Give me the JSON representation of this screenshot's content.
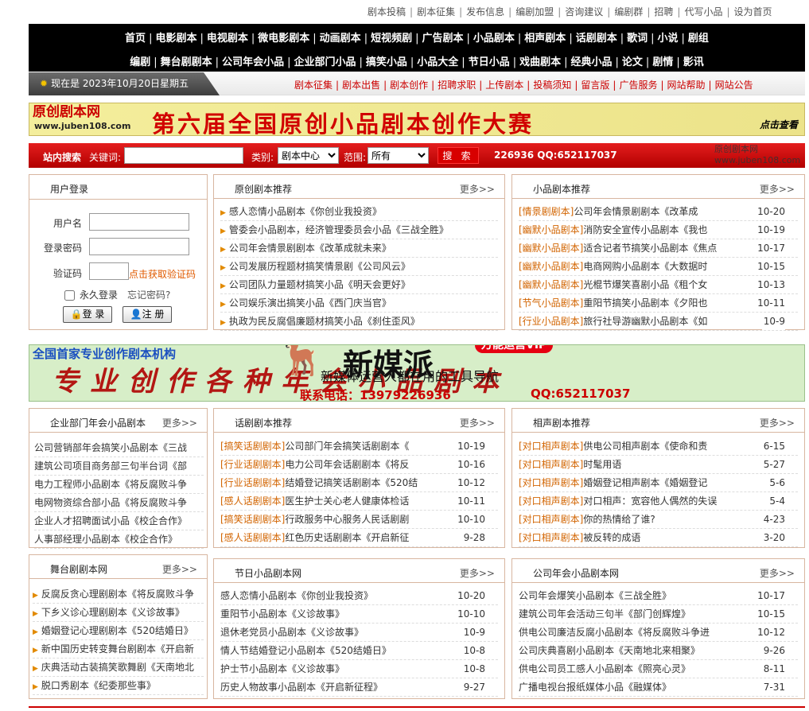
{
  "top_links": [
    "剧本投稿",
    "剧本征集",
    "发布信息",
    "编剧加盟",
    "咨询建议",
    "编剧群",
    "招聘",
    "代写小品",
    "设为首页"
  ],
  "nav_row1": [
    "首页",
    "电影剧本",
    "电视剧本",
    "微电影剧本",
    "动画剧本",
    "短视频剧",
    "广告剧本",
    "小品剧本",
    "相声剧本",
    "话剧剧本",
    "歌词",
    "小说",
    "剧组"
  ],
  "nav_row2": [
    "编剧",
    "舞台剧剧本",
    "公司年会小品",
    "企业部门小品",
    "搞笑小品",
    "小品大全",
    "节日小品",
    "戏曲剧本",
    "经典小品",
    "论文",
    "剧情",
    "影讯"
  ],
  "date_text": "现在是 2023年10月20日星期五",
  "sub_links": [
    "剧本征集",
    "剧本出售",
    "剧本创作",
    "招聘求职",
    "上传剧本",
    "投稿须知",
    "留言版",
    "广告服务",
    "网站帮助",
    "网站公告"
  ],
  "banner1": {
    "logo": "原创剧本网",
    "url": "www.juben108.com",
    "title": "第六届全国原创小品剧本创作大赛",
    "click": "点击查看"
  },
  "search": {
    "site_search": "站内搜索",
    "keyword_label": "关键词:",
    "category_label": "类别:",
    "category_value": "剧本中心",
    "range_label": "范围:",
    "range_value": "所有",
    "button": "搜 索",
    "contact": "226936 QQ:652117037",
    "watermark1": "原创剧本网",
    "watermark2": "www.juben108.com"
  },
  "login": {
    "title": "用户登录",
    "username_label": "用户名",
    "password_label": "登录密码",
    "code_label": "验证码",
    "get_code": "点击获取验证码",
    "remember": "永久登录",
    "forgot": "忘记密码?",
    "login_btn": "登 录",
    "register_btn": "注 册"
  },
  "more": "更多>>",
  "original_recommend": {
    "title": "原创剧本推荐",
    "items": [
      "感人恋情小品剧本《你创业我投资》",
      "管委会小品剧本，经济管理委员会小品《三战全胜》",
      "公司年会情景剧剧本《改革成就未来》",
      "公司发展历程题材搞笑情景剧《公司风云》",
      "公司团队力量题材搞笑小品《明天会更好》",
      "公司娱乐演出搞笑小品《西门庆当官》",
      "执政为民反腐倡廉题材搞笑小品《刹住歪风》"
    ]
  },
  "sketch_recommend": {
    "title": "小品剧本推荐",
    "items": [
      {
        "tag": "[情景剧剧本]",
        "text": "公司年会情景剧剧本《改革成",
        "date": "10-20"
      },
      {
        "tag": "[幽默小品剧本]",
        "text": "消防安全宣传小品剧本《我也",
        "date": "10-19"
      },
      {
        "tag": "[幽默小品剧本]",
        "text": "适合记者节搞笑小品剧本《焦点",
        "date": "10-17"
      },
      {
        "tag": "[幽默小品剧本]",
        "text": "电商网购小品剧本《大数据时",
        "date": "10-15"
      },
      {
        "tag": "[幽默小品剧本]",
        "text": "光棍节爆笑喜剧小品《租个女",
        "date": "10-13"
      },
      {
        "tag": "[节气小品剧本]",
        "text": "重阳节搞笑小品剧本《夕阳也",
        "date": "10-11"
      },
      {
        "tag": "[行业小品剧本]",
        "text": "旅行社导游幽默小品剧本《如",
        "date": "10-9"
      }
    ]
  },
  "banner2": {
    "top": "全国首家专业创作剧本机构",
    "big": "专业创作各种年会小品剧本",
    "phone": "联系电话：13979226936",
    "qq": "QQ:652117037",
    "overlay_name": "新媒派",
    "overlay_badge": "万能运营VIP",
    "overlay_sub": "新媒体运营人都在用的工具导航"
  },
  "enterprise": {
    "title": "企业部门年会小品剧本",
    "items": [
      "公司营销部年会搞笑小品剧本《三战",
      "建筑公司项目商务部三句半台词《部",
      "电力工程师小品剧本《将反腐败斗争",
      "电网物资综合部小品《将反腐败斗争",
      "企业人才招聘面试小品《校企合作》",
      "人事部经理小品剧本《校企合作》"
    ]
  },
  "drama": {
    "title": "话剧剧本推荐",
    "items": [
      {
        "tag": "[搞笑话剧剧本]",
        "text": "公司部门年会搞笑话剧剧本《",
        "date": "10-19"
      },
      {
        "tag": "[行业话剧剧本]",
        "text": "电力公司年会话剧剧本《将反",
        "date": "10-16"
      },
      {
        "tag": "[行业话剧剧本]",
        "text": "结婚登记搞笑话剧剧本《520结",
        "date": "10-12"
      },
      {
        "tag": "[感人话剧剧本]",
        "text": "医生护士关心老人健康体检话",
        "date": "10-11"
      },
      {
        "tag": "[搞笑话剧剧本]",
        "text": "行政服务中心服务人民话剧剧",
        "date": "10-10"
      },
      {
        "tag": "[感人话剧剧本]",
        "text": "红色历史话剧剧本《开启新征",
        "date": "9-28"
      }
    ]
  },
  "crosstalk": {
    "title": "相声剧本推荐",
    "items": [
      {
        "tag": "[对口相声剧本]",
        "text": "供电公司相声剧本《使命和责",
        "date": "6-15"
      },
      {
        "tag": "[对口相声剧本]",
        "text": "时髦用语",
        "date": "5-27"
      },
      {
        "tag": "[对口相声剧本]",
        "text": "婚姻登记相声剧本《婚姻登记",
        "date": "5-6"
      },
      {
        "tag": "[对口相声剧本]",
        "text": "对口相声：宽容他人偶然的失误",
        "date": "5-4"
      },
      {
        "tag": "[对口相声剧本]",
        "text": "你的热情给了谁?",
        "date": "4-23"
      },
      {
        "tag": "[对口相声剧本]",
        "text": "被反转的成语",
        "date": "3-20"
      }
    ]
  },
  "stage": {
    "title": "舞台剧剧本网",
    "items": [
      "反腐反贪心理剧剧本《将反腐败斗争",
      "下乡义诊心理剧剧本《义诊故事》",
      "婚姻登记心理剧剧本《520结婚日》",
      "新中国历史转变舞台剧剧本《开启新",
      "庆典活动古装搞笑歌舞剧《天南地北",
      "脱口秀剧本《纪委那些事》"
    ]
  },
  "festival": {
    "title": "节日小品剧本网",
    "items": [
      {
        "text": "感人恋情小品剧本《你创业我投资》",
        "date": "10-20"
      },
      {
        "text": "重阳节小品剧本《义诊故事》",
        "date": "10-10"
      },
      {
        "text": "退休老党员小品剧本《义诊故事》",
        "date": "10-9"
      },
      {
        "text": "情人节结婚登记小品剧本《520结婚日》",
        "date": "10-8"
      },
      {
        "text": "护士节小品剧本《义诊故事》",
        "date": "10-8"
      },
      {
        "text": "历史人物故事小品剧本《开启新征程》",
        "date": "9-27"
      }
    ]
  },
  "annual": {
    "title": "公司年会小品剧本网",
    "items": [
      {
        "text": "公司年会爆笑小品剧本《三战全胜》",
        "date": "10-17"
      },
      {
        "text": "建筑公司年会活动三句半《部门创辉煌》",
        "date": "10-15"
      },
      {
        "text": "供电公司廉洁反腐小品剧本《将反腐败斗争进",
        "date": "10-12"
      },
      {
        "text": "公司庆典喜剧小品剧本《天南地北来相聚》",
        "date": "9-26"
      },
      {
        "text": "供电公司员工感人小品剧本《照亮心灵》",
        "date": "8-11"
      },
      {
        "text": "广播电视台报纸媒体小品《融媒体》",
        "date": "7-31"
      }
    ]
  },
  "colors": {
    "nav_bg": "#000000",
    "search_bg": "#cc0000",
    "tag": "#d26400",
    "box_border": "#d8b6a0"
  }
}
